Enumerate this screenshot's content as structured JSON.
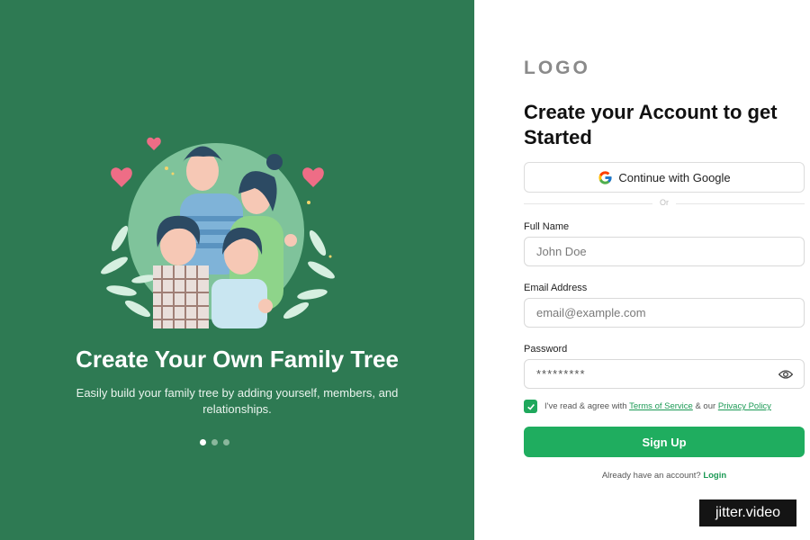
{
  "hero": {
    "title": "Create Your Own Family Tree",
    "subtitle": "Easily build your family tree by adding yourself, members, and relationships.",
    "carousel_dots": 3,
    "carousel_active": 1
  },
  "form": {
    "logo": "LOGO",
    "title": "Create your Account to get Started",
    "google_label": "Continue with Google",
    "divider_label": "Or",
    "full_name": {
      "label": "Full Name",
      "placeholder": "John Doe"
    },
    "email": {
      "label": "Email Address",
      "placeholder": "email@example.com"
    },
    "password": {
      "label": "Password",
      "value": "*********"
    },
    "agree": {
      "checked": true,
      "prefix": "I've read & agree with",
      "terms": "Terms of Service",
      "middle": "& our",
      "privacy": "Privacy Policy"
    },
    "signup_label": "Sign Up",
    "login_prompt": "Already have an account?",
    "login_link": "Login"
  },
  "watermark": "jitter.video",
  "colors": {
    "panel_green": "#2e7a53",
    "accent_green": "#1fad5f",
    "link_green": "#1c9a55"
  }
}
